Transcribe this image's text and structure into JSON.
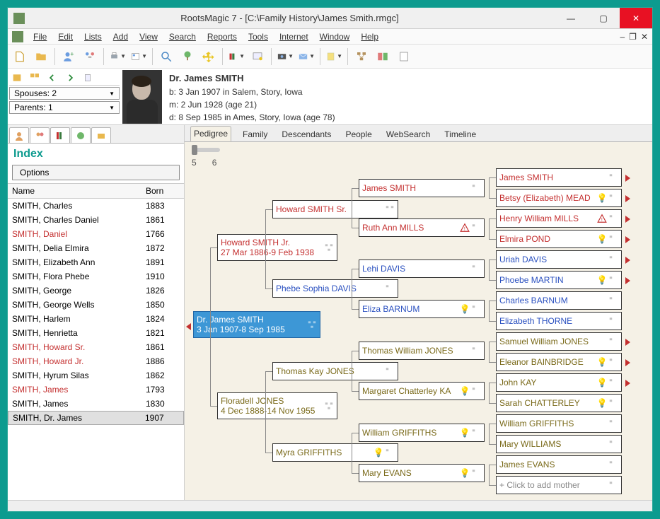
{
  "title": "RootsMagic 7 - [C:\\Family History\\James Smith.rmgc]",
  "menus": [
    "File",
    "Edit",
    "Lists",
    "Add",
    "View",
    "Search",
    "Reports",
    "Tools",
    "Internet",
    "Window",
    "Help"
  ],
  "spouses": {
    "label": "Spouses:",
    "count": "2"
  },
  "parents": {
    "label": "Parents:",
    "count": "1"
  },
  "person": {
    "name": "Dr. James SMITH",
    "birth": "b: 3 Jan 1907 in Salem, Story, Iowa",
    "marriage": "m: 2 Jun 1928 (age 21)",
    "death": "d: 8 Sep 1985 in Ames, Story, Iowa (age 78)"
  },
  "side": {
    "heading": "Index",
    "options": "Options",
    "hdr_name": "Name",
    "hdr_born": "Born",
    "rows": [
      {
        "n": "SMITH, Charles",
        "b": "1883",
        "c": ""
      },
      {
        "n": "SMITH, Charles Daniel",
        "b": "1861",
        "c": ""
      },
      {
        "n": "SMITH, Daniel",
        "b": "1766",
        "c": "red"
      },
      {
        "n": "SMITH, Delia Elmira",
        "b": "1872",
        "c": ""
      },
      {
        "n": "SMITH, Elizabeth Ann",
        "b": "1891",
        "c": ""
      },
      {
        "n": "SMITH, Flora Phebe",
        "b": "1910",
        "c": ""
      },
      {
        "n": "SMITH, George",
        "b": "1826",
        "c": ""
      },
      {
        "n": "SMITH, George Wells",
        "b": "1850",
        "c": ""
      },
      {
        "n": "SMITH, Harlem",
        "b": "1824",
        "c": ""
      },
      {
        "n": "SMITH, Henrietta",
        "b": "1821",
        "c": ""
      },
      {
        "n": "SMITH, Howard Sr.",
        "b": "1861",
        "c": "red"
      },
      {
        "n": "SMITH, Howard Jr.",
        "b": "1886",
        "c": "red"
      },
      {
        "n": "SMITH, Hyrum Silas",
        "b": "1862",
        "c": ""
      },
      {
        "n": "SMITH, James",
        "b": "1793",
        "c": "red"
      },
      {
        "n": "SMITH, James",
        "b": "1830",
        "c": ""
      },
      {
        "n": "SMITH, Dr. James",
        "b": "1907",
        "c": "",
        "sel": true
      }
    ]
  },
  "view_tabs": [
    "Pedigree",
    "Family",
    "Descendants",
    "People",
    "WebSearch",
    "Timeline"
  ],
  "gens": {
    "a": "5",
    "b": "6"
  },
  "focus": {
    "name": "Dr. James SMITH",
    "dates": "3 Jan 1907-8 Sep 1985"
  },
  "g2a": {
    "name": "Howard SMITH Jr.",
    "dates": "27 Mar 1886-9 Feb 1938"
  },
  "g2b": {
    "name": "Floradell JONES",
    "dates": "4 Dec 1888-14 Nov 1955"
  },
  "g3": {
    "a": "Howard SMITH Sr.",
    "b": "Phebe Sophia DAVIS",
    "c": "Thomas Kay JONES",
    "d": "Myra GRIFFITHS"
  },
  "g4": {
    "a": "James SMITH",
    "b": "Ruth Ann MILLS",
    "c": "Lehi DAVIS",
    "d": "Eliza BARNUM",
    "e": "Thomas William JONES",
    "f": "Margaret Chatterley KA",
    "g": "William GRIFFITHS",
    "h": "Mary EVANS"
  },
  "g5": {
    "a": "James SMITH",
    "b": "Betsy (Elizabeth) MEAD",
    "c": "Henry William MILLS",
    "d": "Elmira POND",
    "e": "Uriah DAVIS",
    "f": "Phoebe MARTIN",
    "g": "Charles BARNUM",
    "h": "Elizabeth THORNE",
    "i": "Samuel William JONES",
    "j": "Eleanor BAINBRIDGE",
    "k": "John KAY",
    "l": "Sarah CHATTERLEY",
    "m": "William GRIFFITHS",
    "n": "Mary WILLIAMS",
    "o": "James EVANS",
    "p": "+ Click to add mother"
  }
}
